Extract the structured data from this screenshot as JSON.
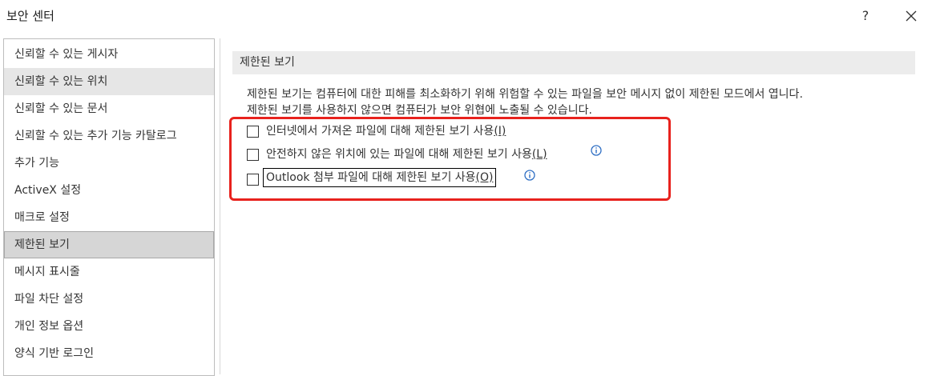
{
  "window": {
    "title": "보안 센터",
    "help_label": "?"
  },
  "sidebar": {
    "items": [
      {
        "label": "신뢰할 수 있는 게시자"
      },
      {
        "label": "신뢰할 수 있는 위치"
      },
      {
        "label": "신뢰할 수 있는 문서"
      },
      {
        "label": "신뢰할 수 있는 추가 기능 카탈로그"
      },
      {
        "label": "추가 기능"
      },
      {
        "label": "ActiveX 설정"
      },
      {
        "label": "매크로 설정"
      },
      {
        "label": "제한된 보기"
      },
      {
        "label": "메시지 표시줄"
      },
      {
        "label": "파일 차단 설정"
      },
      {
        "label": "개인 정보 옵션"
      },
      {
        "label": "양식 기반 로그인"
      }
    ],
    "hovered_item": "신뢰할 수 있는 위치",
    "selected_item": "제한된 보기"
  },
  "main": {
    "section_title": "제한된 보기",
    "description_line1": "제한된 보기는 컴퓨터에 대한 피해를 최소화하기 위해 위험할 수 있는 파일을 보안 메시지 없이 제한된 모드에서 엽니다.",
    "description_line2": "제한된 보기를 사용하지 않으면 컴퓨터가 보안 위협에 노출될 수 있습니다.",
    "options": [
      {
        "text": "인터넷에서 가져온 파일에 대해 제한된 보기 사용",
        "access_key": "(I)",
        "checked": false,
        "has_info": false
      },
      {
        "text": "안전하지 않은 위치에 있는 파일에 대해 제한된 보기 사용",
        "access_key": "(L)",
        "checked": false,
        "has_info": true
      },
      {
        "text": "Outlook 첨부 파일에 대해 제한된 보기 사용",
        "access_key": "(O)",
        "checked": false,
        "has_info": true
      }
    ]
  },
  "colors": {
    "highlight_border": "#e8221d",
    "info_icon": "#2f6fc4",
    "selected_bg": "#d6d6d6",
    "section_header_bg": "#ececec"
  },
  "icons": [
    "close-icon",
    "info-icon"
  ]
}
